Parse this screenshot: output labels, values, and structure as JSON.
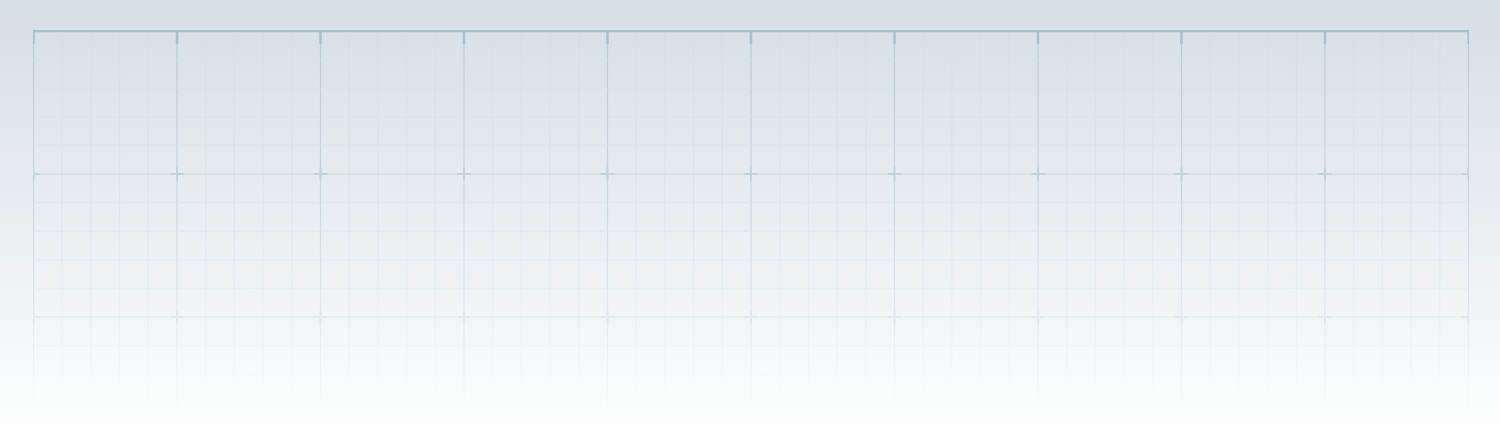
{
  "canvas": {
    "kind": "grid"
  }
}
